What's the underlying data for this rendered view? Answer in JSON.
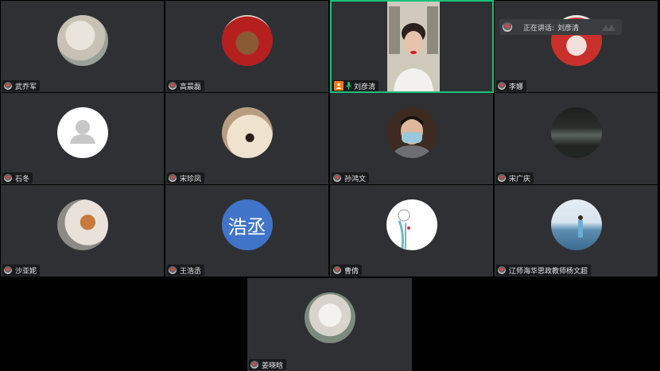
{
  "participants": [
    {
      "name": "武乔军",
      "avatar_type": "photo",
      "avatar_colors": [
        "#e9e5dc",
        "#9aa09a"
      ]
    },
    {
      "name": "高晨磊",
      "avatar_type": "photo",
      "avatar_colors": [
        "#b5201f",
        "#7a4a2e"
      ]
    },
    {
      "name": "刘彦清",
      "avatar_type": "video",
      "is_host": true,
      "mic_on": true
    },
    {
      "name": "李娜",
      "avatar_type": "photo",
      "avatar_colors": [
        "#c9302c",
        "#f1e0dc"
      ]
    },
    {
      "name": "石冬",
      "avatar_type": "default",
      "avatar_colors": [
        "#ffffff",
        "#c7c7c7"
      ]
    },
    {
      "name": "宋珍凤",
      "avatar_type": "photo",
      "avatar_colors": [
        "#efe2cf",
        "#b89d82"
      ]
    },
    {
      "name": "孙鸿文",
      "avatar_type": "photo",
      "avatar_colors": [
        "#3d2a20",
        "#9bc7db"
      ]
    },
    {
      "name": "宋广庆",
      "avatar_type": "photo",
      "avatar_colors": [
        "#1c1f1d",
        "#5b6460"
      ]
    },
    {
      "name": "沙亚妮",
      "avatar_type": "photo",
      "avatar_colors": [
        "#e8e2da",
        "#8d5a3b"
      ]
    },
    {
      "name": "王浩丞",
      "avatar_type": "text",
      "avatar_text": "浩丞",
      "avatar_colors": [
        "#3f74c8",
        "#3f74c8"
      ]
    },
    {
      "name": "曹倩",
      "avatar_type": "photo",
      "avatar_colors": [
        "#ffffff",
        "#6fb9c6"
      ]
    },
    {
      "name": "辽师海华思政教师杨文超",
      "avatar_type": "photo",
      "avatar_colors": [
        "#d7e4ef",
        "#5d8fb3"
      ]
    },
    {
      "name": "姜晓晗",
      "avatar_type": "photo",
      "avatar_colors": [
        "#e6e4e0",
        "#7d8a7e"
      ]
    }
  ],
  "speaking_indicator": {
    "label": "正在讲话:",
    "speaker": "刘彦清"
  },
  "colors": {
    "tile_bg": "#2e3033",
    "active_border": "#19c27a",
    "host_badge": "#f07a1a",
    "mic_green": "#19c27a"
  }
}
